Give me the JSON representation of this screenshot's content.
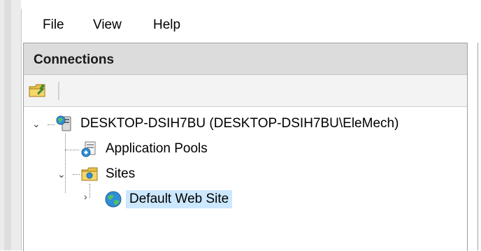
{
  "menu": [
    {
      "name": "menu-file",
      "label": "File"
    },
    {
      "name": "menu-view",
      "label": "View"
    },
    {
      "name": "menu-help",
      "label": "Help"
    }
  ],
  "connections": {
    "title": "Connections",
    "tree": {
      "server": {
        "label": "DESKTOP-DSIH7BU (DESKTOP-DSIH7BU\\EleMech)",
        "icon": "server-icon",
        "expanded": true
      },
      "app_pools": {
        "label": "Application Pools",
        "icon": "application-pools-icon"
      },
      "sites": {
        "label": "Sites",
        "icon": "sites-folder-icon",
        "expanded": true
      },
      "default_site": {
        "label": "Default Web Site",
        "icon": "globe-icon",
        "selected": true,
        "expanded": false
      }
    }
  },
  "colors": {
    "selection": "#cce8ff",
    "header": "#dcdcdc",
    "toolbar": "#f3f3f3"
  }
}
